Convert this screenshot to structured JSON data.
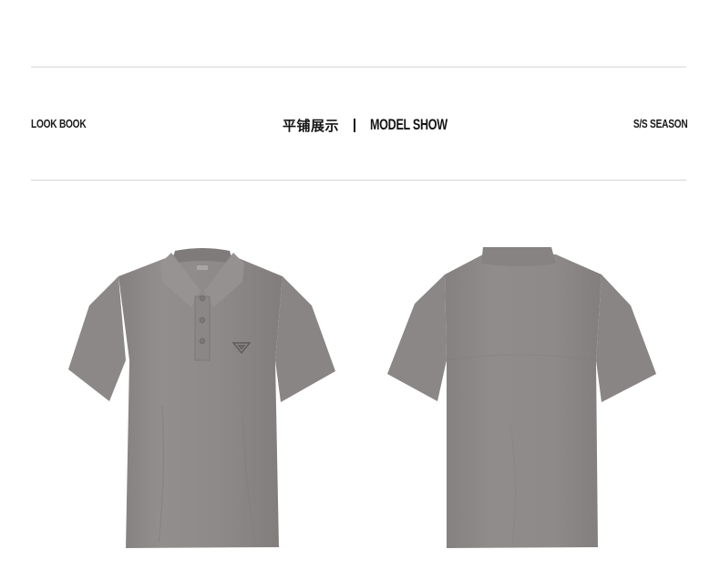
{
  "header": {
    "left_label": "LOOK BOOK",
    "center_cn": "平铺展示",
    "center_en": "MODEL SHOW",
    "right_label": "S/S SEASON"
  },
  "products": [
    {
      "view": "front",
      "color": "#8f8b8b",
      "logo": "triangle-emblem"
    },
    {
      "view": "back",
      "color": "#8f8b8b"
    }
  ]
}
